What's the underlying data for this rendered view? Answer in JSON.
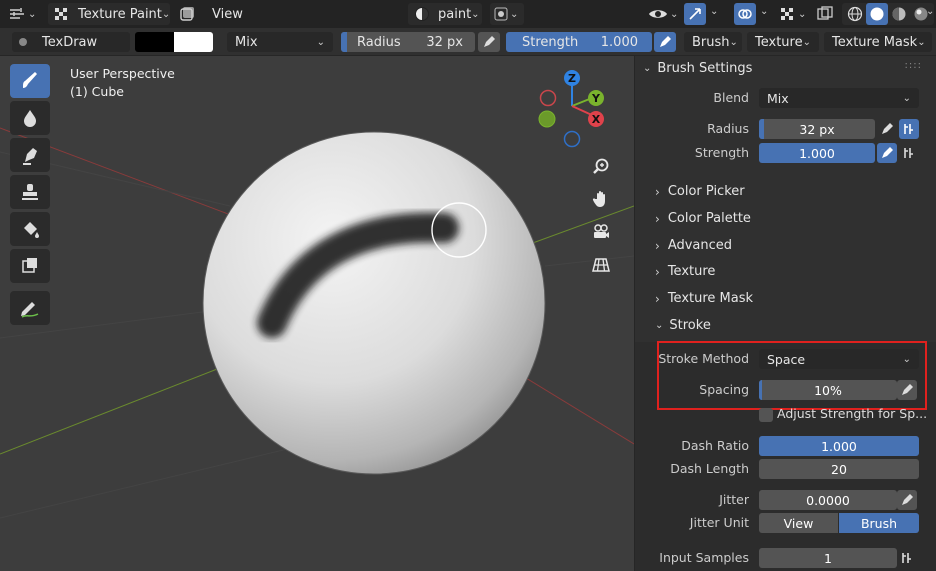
{
  "header": {
    "mode_label": "Texture Paint",
    "view_label": "View",
    "paint_slot": "paint",
    "colors": {
      "accent": "#4772b3",
      "panel_bg": "#303030",
      "viewport_bg": "#3d3d3d"
    }
  },
  "tool_settings": {
    "brush_name": "TexDraw",
    "blend_mode": "Mix",
    "radius_label": "Radius",
    "radius_value": "32 px",
    "strength_label": "Strength",
    "strength_value": "1.000",
    "brush_menu": "Brush",
    "texture_menu": "Texture",
    "texture_mask_menu": "Texture Mask"
  },
  "viewport": {
    "perspective_label": "User Perspective",
    "object_label": "(1) Cube",
    "gizmo": {
      "z": "Z",
      "y": "Y",
      "x": "X"
    }
  },
  "panel": {
    "title": "Brush Settings",
    "blend_label": "Blend",
    "blend_value": "Mix",
    "radius_label": "Radius",
    "radius_value": "32 px",
    "radius_fill": 0.04,
    "strength_label": "Strength",
    "strength_value": "1.000",
    "sections": [
      "Color Picker",
      "Color Palette",
      "Advanced",
      "Texture",
      "Texture Mask"
    ],
    "stroke_section": "Stroke",
    "stroke_method_label": "Stroke Method",
    "stroke_method_value": "Space",
    "spacing_label": "Spacing",
    "spacing_value": "10%",
    "spacing_fill": 0.01,
    "adjust_strength_label": "Adjust Strength for Sp...",
    "dash_ratio_label": "Dash Ratio",
    "dash_ratio_value": "1.000",
    "dash_length_label": "Dash Length",
    "dash_length_value": "20",
    "jitter_label": "Jitter",
    "jitter_value": "0.0000",
    "jitter_unit_label": "Jitter Unit",
    "jitter_unit_view": "View",
    "jitter_unit_brush": "Brush",
    "input_samples_label": "Input Samples",
    "input_samples_value": "1"
  }
}
